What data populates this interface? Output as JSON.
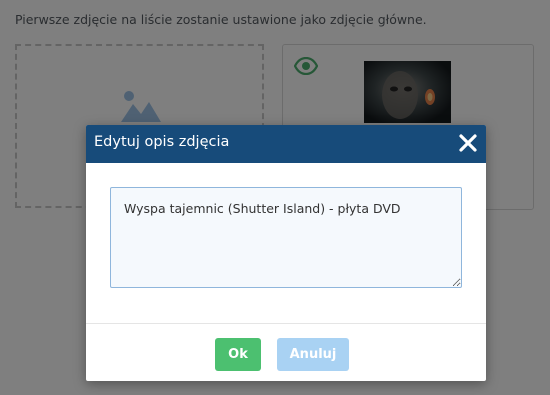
{
  "page": {
    "hint_text": "Pierwsze zdjęcie na liście zostanie ustawione jako zdjęcie główne."
  },
  "upload": {
    "icon": "image-placeholder-icon"
  },
  "photo_card": {
    "visibility_icon": "eye-icon",
    "thumbnail_alt": "Wyspa tajemnic (Shutter Island) - płyta DVD"
  },
  "modal": {
    "title": "Edytuj opis zdjęcia",
    "close_icon": "close-icon",
    "description_value": "Wyspa tajemnic (Shutter Island) - płyta DVD",
    "ok_label": "Ok",
    "cancel_label": "Anuluj"
  },
  "colors": {
    "header_bg": "#174b7a",
    "ok_button": "#4cc070",
    "cancel_button": "#a9d2f3",
    "eye_icon": "#4cae6e"
  }
}
